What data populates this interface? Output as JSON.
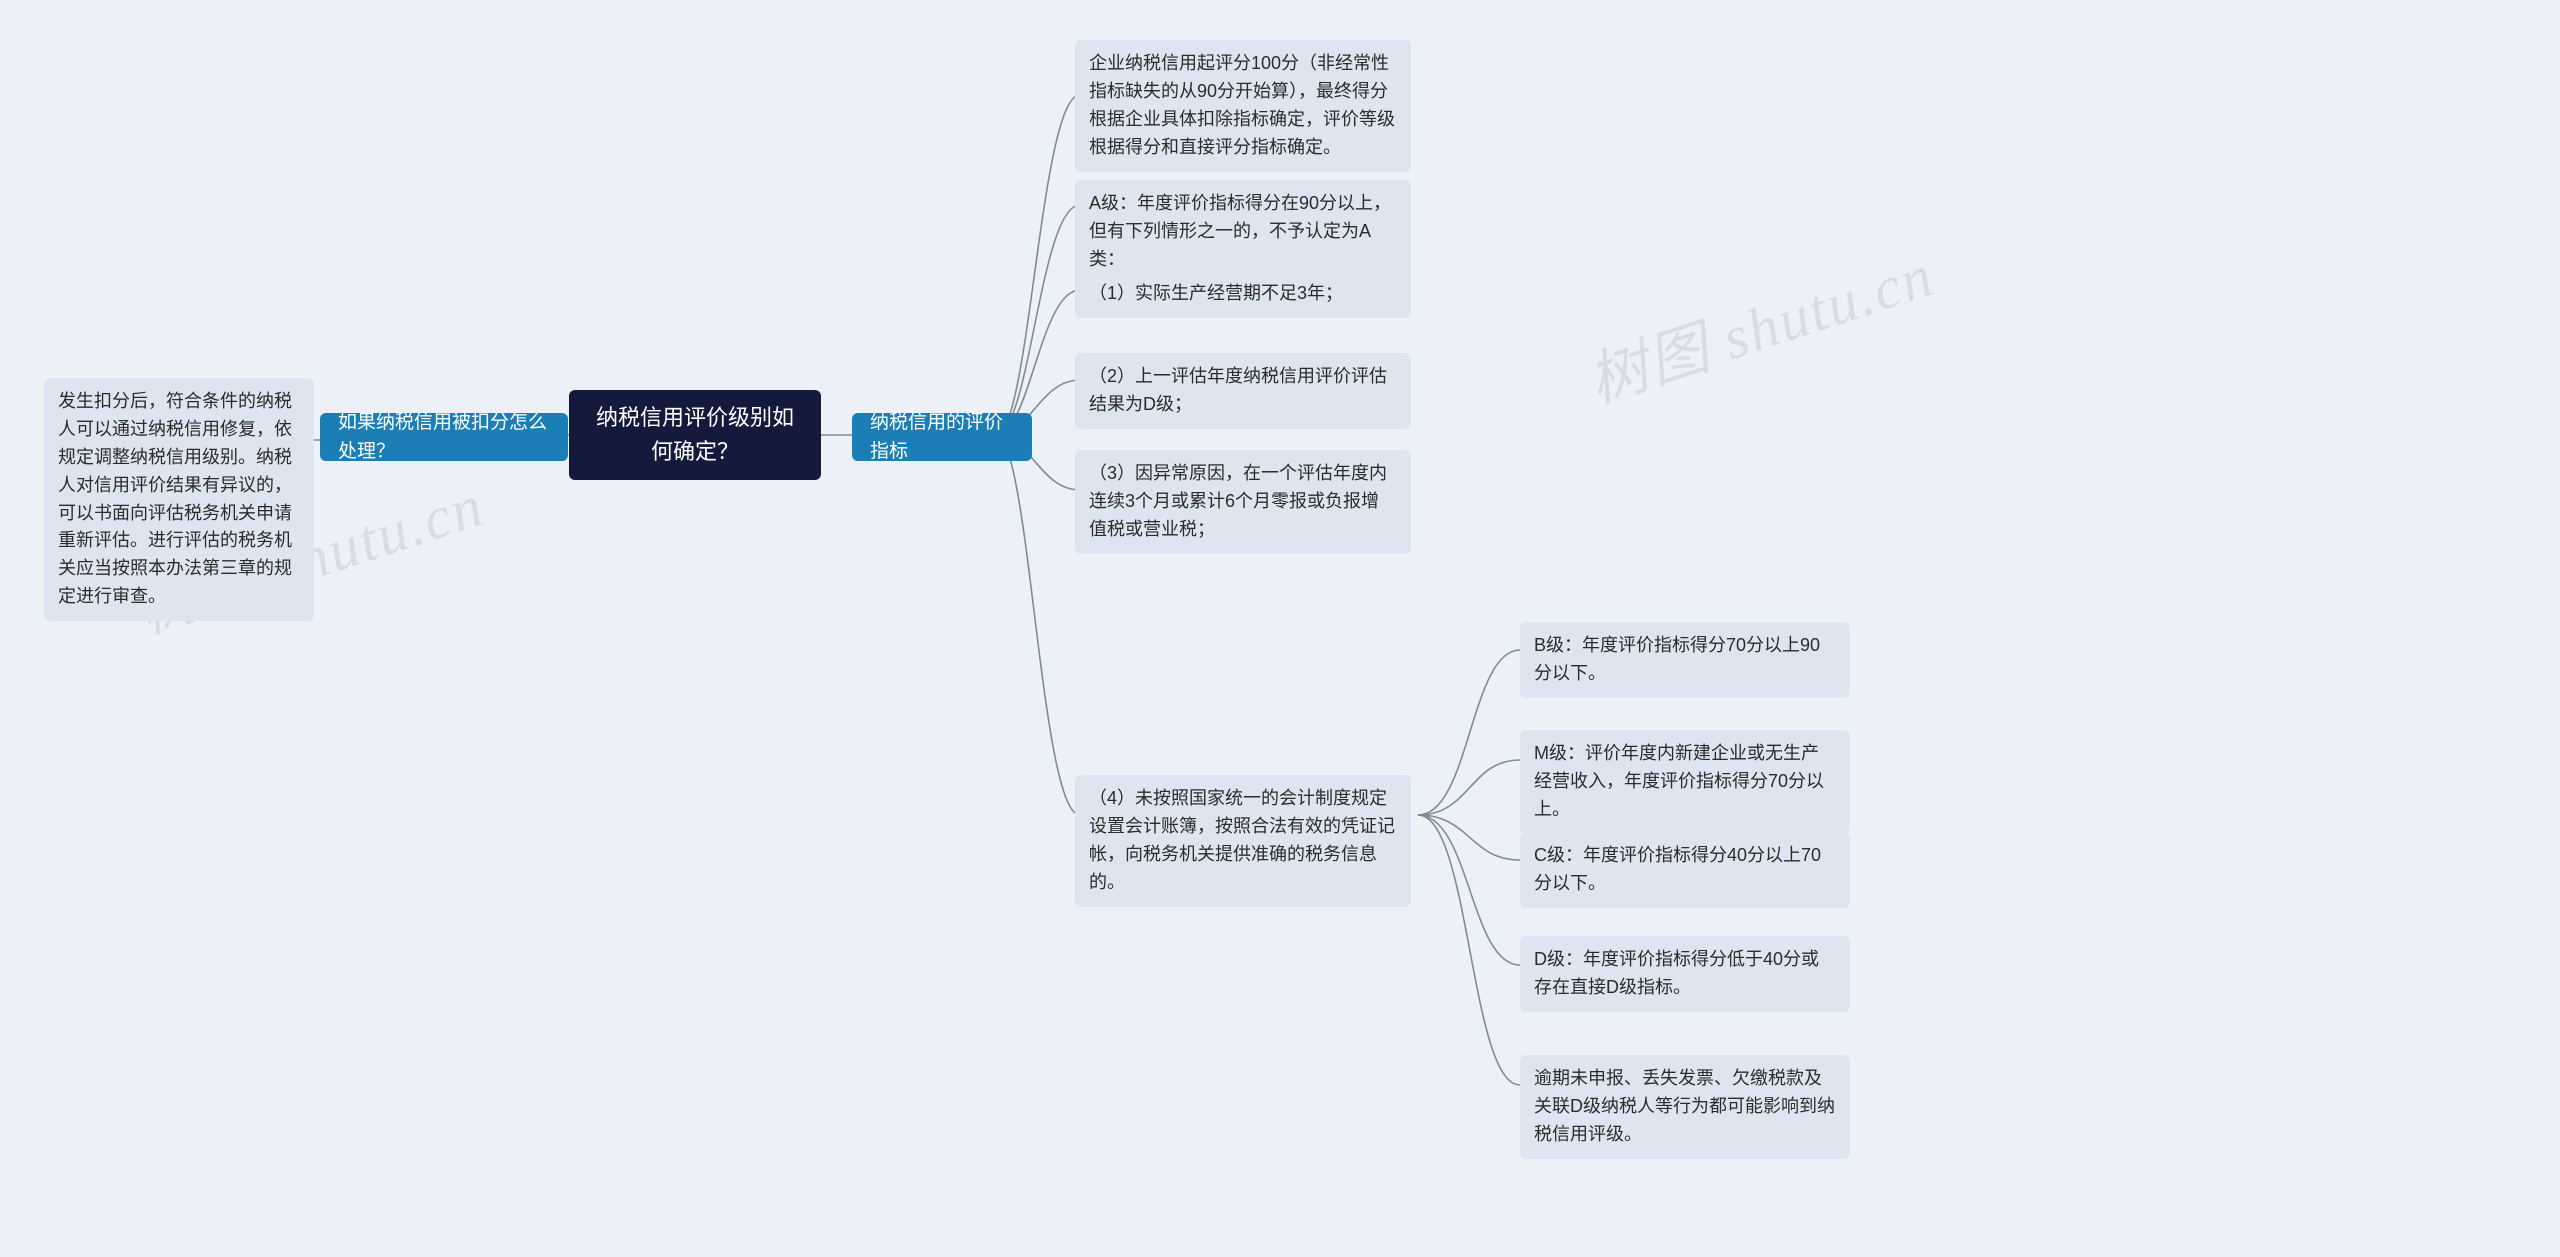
{
  "root": {
    "text": "纳税信用评价级别如何确定？"
  },
  "left": {
    "primary": "如果纳税信用被扣分怎么处理？",
    "leaf": "发生扣分后，符合条件的纳税人可以通过纳税信用修复，依规定调整纳税信用级别。纳税人对信用评价结果有异议的，可以书面向评估税务机关申请重新评估。进行评估的税务机关应当按照本办法第三章的规定进行审查。"
  },
  "right": {
    "primary": "纳税信用的评价指标",
    "children": {
      "c1": "企业纳税信用起评分100分（非经常性指标缺失的从90分开始算），最终得分根据企业具体扣除指标确定，评价等级根据得分和直接评分指标确定。",
      "c2": "A级：年度评价指标得分在90分以上，但有下列情形之一的，不予认定为A类：",
      "c3": "（1）实际生产经营期不足3年；",
      "c4": "（2）上一评估年度纳税信用评价评估结果为D级；",
      "c5": "（3）因异常原因，在一个评估年度内连续3个月或累计6个月零报或负报增值税或营业税；",
      "c6": "（4）未按照国家统一的会计制度规定设置会计账簿，按照合法有效的凭证记帐，向税务机关提供准确的税务信息的。",
      "grand": {
        "g1": "B级：年度评价指标得分70分以上90分以下。",
        "g2": "M级：评价年度内新建企业或无生产经营收入，年度评价指标得分70分以上。",
        "g3": "C级：年度评价指标得分40分以上70分以下。",
        "g4": "D级：年度评价指标得分低于40分或存在直接D级指标。",
        "g5": "逾期未申报、丢失发票、欠缴税款及关联D级纳税人等行为都可能影响到纳税信用评级。"
      }
    }
  },
  "watermark": "树图 shutu.cn"
}
